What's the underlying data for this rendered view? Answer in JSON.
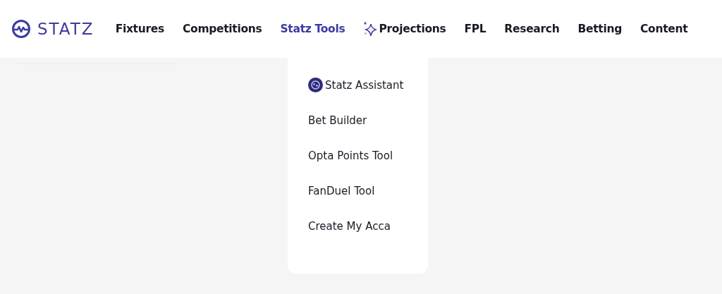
{
  "logo": {
    "text": "STATZ"
  },
  "nav": [
    {
      "label": "Fixtures",
      "selected": false,
      "kind": "plain"
    },
    {
      "label": "Competitions",
      "selected": false,
      "kind": "plain"
    },
    {
      "label": "Statz Tools",
      "selected": true,
      "kind": "plain"
    },
    {
      "label": "Projections",
      "selected": false,
      "kind": "sparkle"
    },
    {
      "label": "FPL",
      "selected": false,
      "kind": "plain"
    },
    {
      "label": "Research",
      "selected": false,
      "kind": "plain"
    },
    {
      "label": "Betting",
      "selected": false,
      "kind": "plain"
    },
    {
      "label": "Content",
      "selected": false,
      "kind": "plain"
    }
  ],
  "dropdown": {
    "items": [
      {
        "label": "Statz Assistant",
        "kind": "assistant"
      },
      {
        "label": "Bet Builder",
        "kind": "plain"
      },
      {
        "label": "Opta Points Tool",
        "kind": "plain"
      },
      {
        "label": "FanDuel Tool",
        "kind": "plain"
      },
      {
        "label": "Create My Acca",
        "kind": "plain"
      }
    ]
  }
}
